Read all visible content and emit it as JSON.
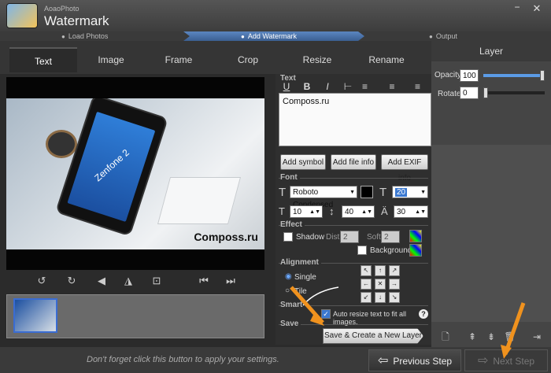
{
  "app": {
    "vendor": "AoaoPhoto",
    "title": "Watermark",
    "minimize": "−",
    "close": "✕"
  },
  "steps": [
    {
      "label": "Load Photos"
    },
    {
      "label": "Add Watermark"
    },
    {
      "label": "Output"
    }
  ],
  "tabs": [
    {
      "label": "Text"
    },
    {
      "label": "Image"
    },
    {
      "label": "Frame"
    },
    {
      "label": "Crop"
    },
    {
      "label": "Resize"
    },
    {
      "label": "Rename"
    }
  ],
  "preview": {
    "phone_text": "Zenfone 2",
    "watermark": "Composs.ru"
  },
  "rotate_icons": {
    "rotate_left": "↺",
    "rotate_right": "↻",
    "flip_v": "◀",
    "flip_h": "◮",
    "fit": "⊡",
    "prev": "⏮",
    "next": "⏭"
  },
  "text_section": {
    "label": "Text",
    "tools": {
      "underline": "U",
      "bold": "B",
      "italic": "I",
      "spacing": "⊢",
      "align_left": "≡",
      "align_center": "≡",
      "align_right": "≡"
    },
    "content": "Composs.ru",
    "add_symbol": "Add symbol",
    "add_file_info": "Add file info",
    "add_exif": "Add EXIF info"
  },
  "font_section": {
    "label": "Font",
    "font_name": "Roboto Condensed",
    "size": "20",
    "line_height": "10",
    "letter_spacing": "40",
    "opacity": "30"
  },
  "effect_section": {
    "label": "Effect",
    "shadow": "Shadow",
    "dist_label": "Dist",
    "dist": "2",
    "soft_label": "Soft",
    "soft": "2",
    "background": "Background"
  },
  "alignment_section": {
    "label": "Alignment",
    "single": "Single",
    "tile": "Tile",
    "grid": [
      "↖",
      "↑",
      "↗",
      "←",
      "✕",
      "→",
      "↙",
      "↓",
      "↘"
    ]
  },
  "smart_section": {
    "label": "Smart",
    "auto_resize": "Auto resize text to fit all images.",
    "help": "?"
  },
  "save_section": {
    "label": "Save",
    "button": "Save & Create a New Layer"
  },
  "layer_panel": {
    "title": "Layer",
    "opacity_label": "Opacity",
    "opacity": "100",
    "rotate_label": "Rotate",
    "rotate": "0",
    "opacity_level": 1.0,
    "rotate_level": 0.0
  },
  "bottom": {
    "hint": "Don't forget click this button to apply your settings.",
    "prev": "Previous Step",
    "next": "Next Step"
  },
  "colors": {
    "accent": "#4a7bc0",
    "annotation": "#f0921e"
  }
}
